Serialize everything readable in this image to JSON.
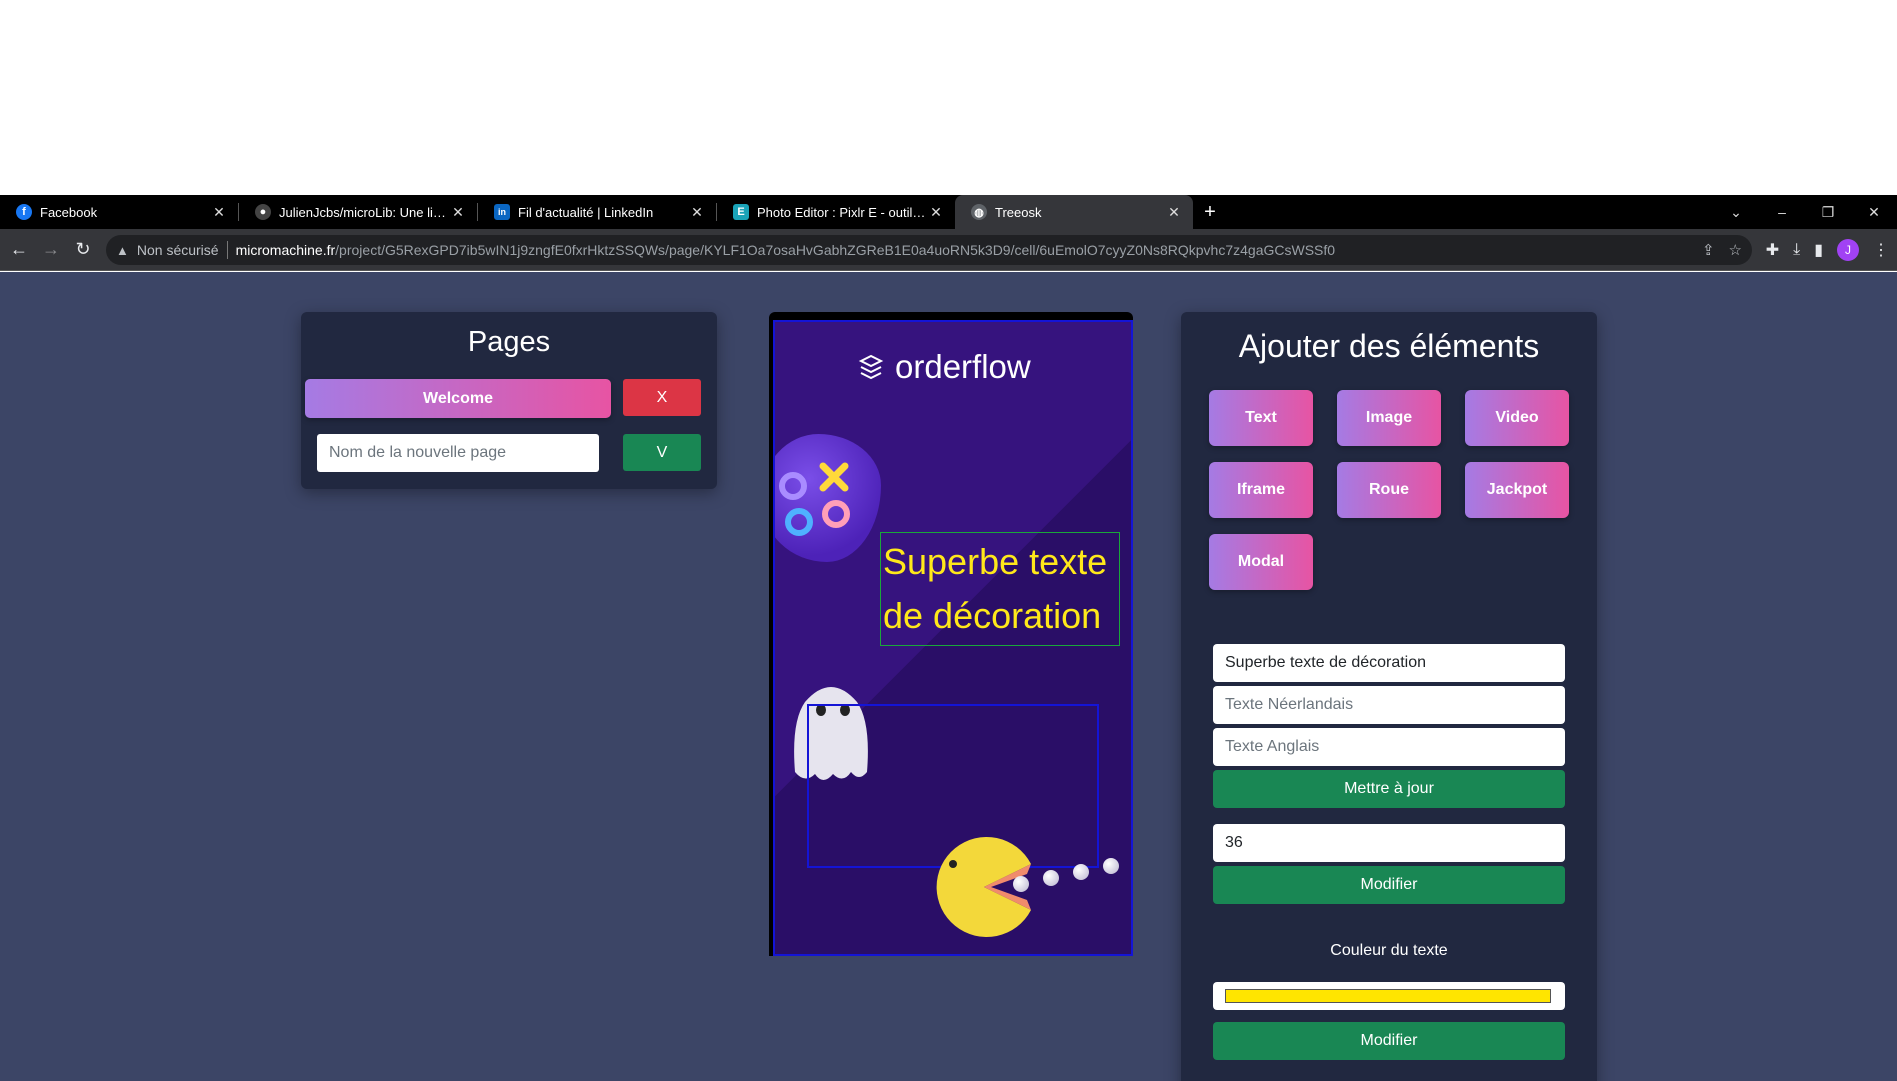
{
  "browser": {
    "tabs": [
      {
        "title": "Facebook",
        "icon": "facebook-icon",
        "color": "#1877f2",
        "glyph": "f"
      },
      {
        "title": "JulienJcbs/microLib: Une librairie",
        "icon": "github-icon",
        "color": "#333333",
        "glyph": "●"
      },
      {
        "title": "Fil d'actualité | LinkedIn",
        "icon": "linkedin-icon",
        "color": "#0a66c2",
        "glyph": "in"
      },
      {
        "title": "Photo Editor : Pixlr E - outil retouche",
        "icon": "pixlr-icon",
        "color": "#1aa3b8",
        "glyph": "E"
      },
      {
        "title": "Treeosk",
        "icon": "globe-icon",
        "color": "#5f6368",
        "glyph": "◍"
      }
    ],
    "security_label": "Non sécurisé",
    "url_host": "micromachine.fr",
    "url_path": "/project/G5RexGPD7ib5wIN1j9zngfE0fxrHktzSSQWs/page/KYLF1Oa7osaHvGabhZGReB1E0a4uoRN5k3D9/cell/6uEmolO7cyyZ0Ns8RQkpvhc7z4gaGCsWSSf0",
    "profile_initial": "J"
  },
  "pages_panel": {
    "title": "Pages",
    "page_button": "Welcome",
    "delete_label": "X",
    "new_page_placeholder": "Nom de la nouvelle page",
    "confirm_label": "V"
  },
  "preview": {
    "brand": "orderflow",
    "decoration_text": "Superbe texte de décoration",
    "text_color": "#ffe81a"
  },
  "elements_panel": {
    "title": "Ajouter des éléments",
    "buttons": [
      "Text",
      "Image",
      "Video",
      "Iframe",
      "Roue",
      "Jackpot",
      "Modal"
    ],
    "text_fr_value": "Superbe texte de décoration",
    "text_nl_placeholder": "Texte Néerlandais",
    "text_en_placeholder": "Texte Anglais",
    "update_label": "Mettre à jour",
    "font_size_value": "36",
    "modify_label": "Modifier",
    "color_label": "Couleur du texte",
    "color_value": "#ffe500",
    "modify_color_label": "Modifier"
  }
}
